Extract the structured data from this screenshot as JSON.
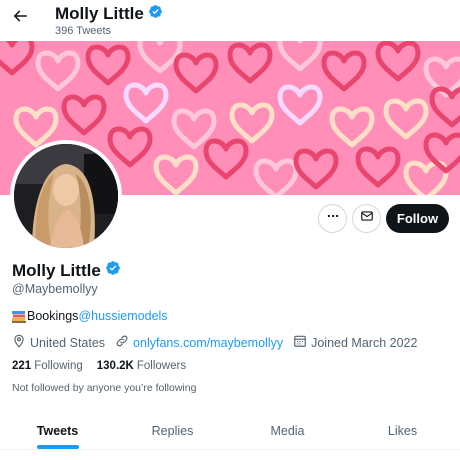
{
  "header": {
    "name": "Molly Little",
    "tweet_count": "396 Tweets",
    "back_icon": "arrow-left-icon",
    "verified_icon": "verified-badge-icon"
  },
  "banner": {
    "background_color": "#ff8fb8",
    "pattern": "hearts"
  },
  "actions": {
    "more_icon": "more-horizontal-icon",
    "message_icon": "envelope-icon",
    "follow_label": "Follow"
  },
  "profile": {
    "name": "Molly Little",
    "handle": "@Maybemollyy",
    "bio_text": "Bookings ",
    "bio_mention": "@hussiemodels",
    "location": "United States",
    "website": "onlyfans.com/maybemollyy",
    "joined": "Joined March 2022",
    "following_count": "221",
    "following_label": "Following",
    "followers_count": "130.2K",
    "followers_label": "Followers",
    "not_followed": "Not followed by anyone you’re following"
  },
  "tabs": [
    {
      "label": "Tweets",
      "active": true
    },
    {
      "label": "Replies",
      "active": false
    },
    {
      "label": "Media",
      "active": false
    },
    {
      "label": "Likes",
      "active": false
    }
  ],
  "colors": {
    "accent": "#1d9bf0",
    "text": "#0f1419",
    "muted": "#536471",
    "follow_bg": "#0f1419"
  }
}
